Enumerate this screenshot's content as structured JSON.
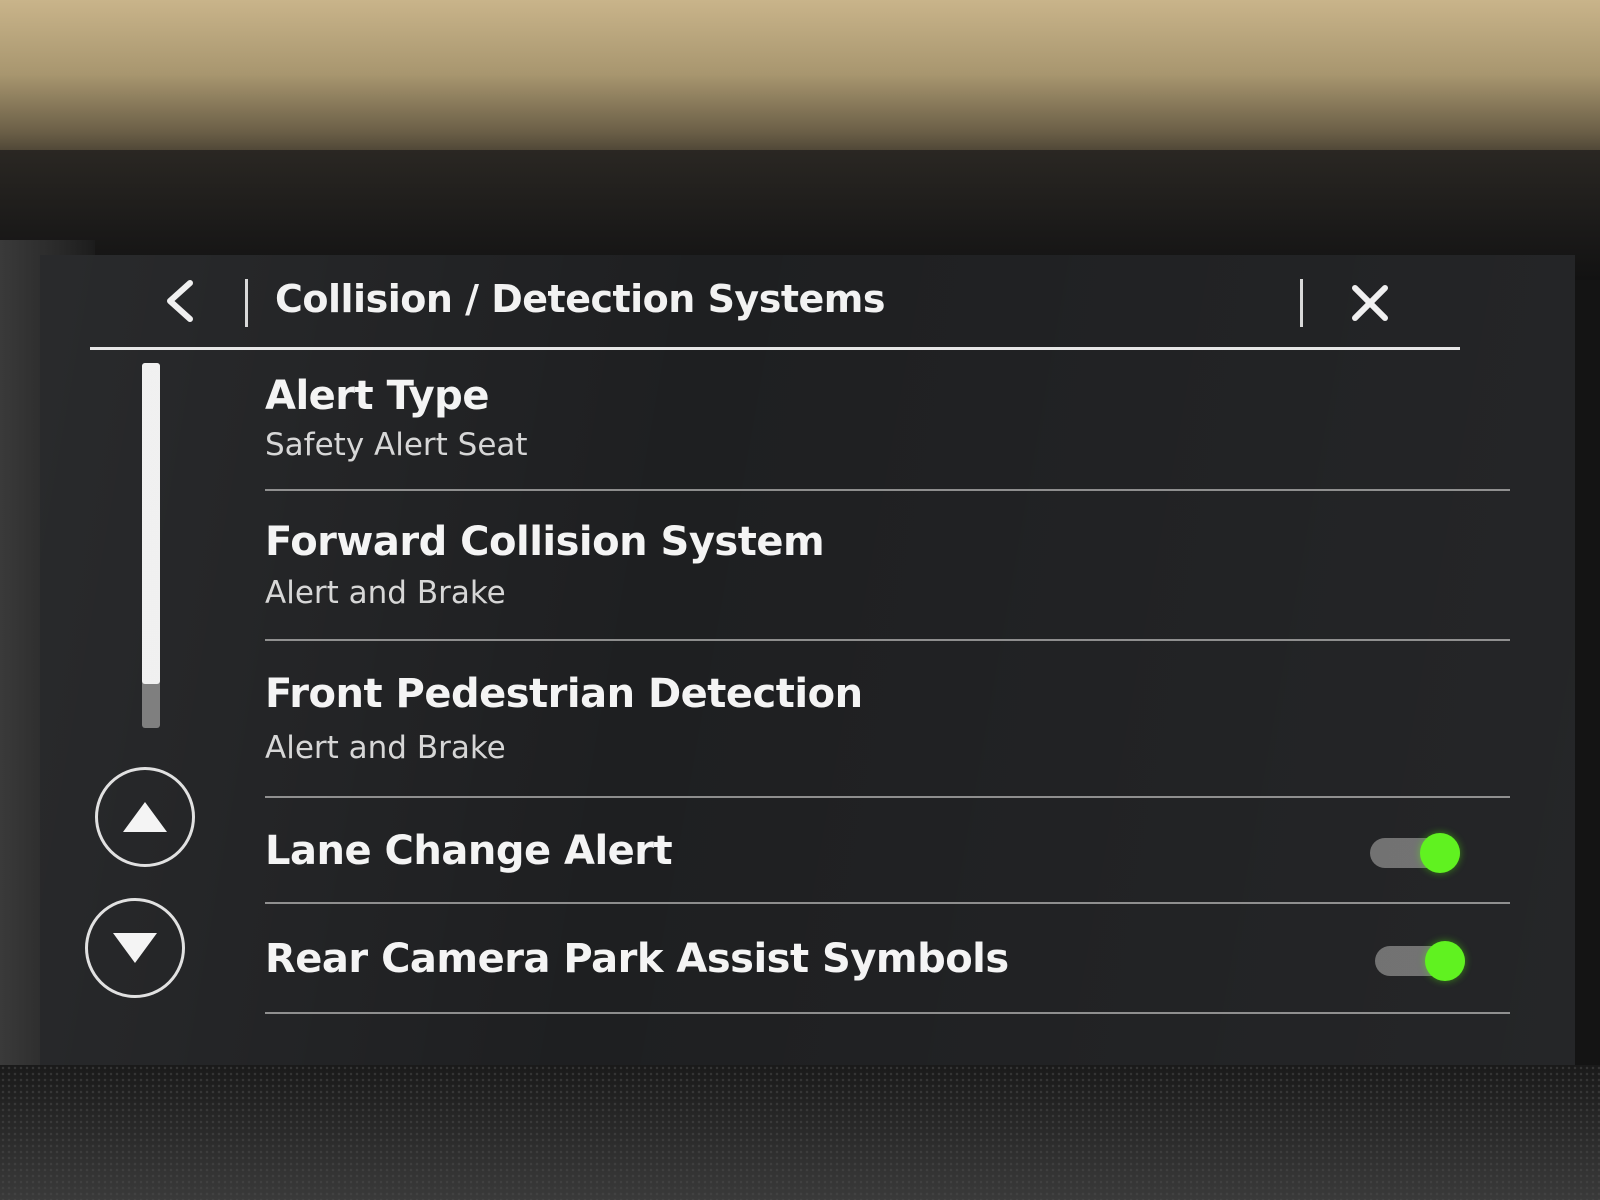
{
  "header": {
    "title": "Collision / Detection Systems",
    "back_icon": "chevron-left-icon",
    "close_icon": "close-icon"
  },
  "scrollbar": {
    "position_fraction": 0.0,
    "visible_fraction": 0.88
  },
  "nav": {
    "page_up_icon": "triangle-up-icon",
    "page_down_icon": "triangle-down-icon"
  },
  "items": [
    {
      "title": "Alert Type",
      "subtitle": "Safety Alert Seat"
    },
    {
      "title": "Forward Collision System",
      "subtitle": "Alert and Brake"
    },
    {
      "title": "Front Pedestrian Detection",
      "subtitle": "Alert and Brake"
    },
    {
      "title": "Lane Change Alert",
      "toggle": "on"
    },
    {
      "title": "Rear Camera Park Assist Symbols",
      "toggle": "on"
    }
  ],
  "colors": {
    "screen_background": "#1e1f21",
    "text_primary": "#f4f4f4",
    "text_secondary": "#d6d6d6",
    "toggle_on": "#5cf21a",
    "toggle_track": "#6f6f6f"
  }
}
